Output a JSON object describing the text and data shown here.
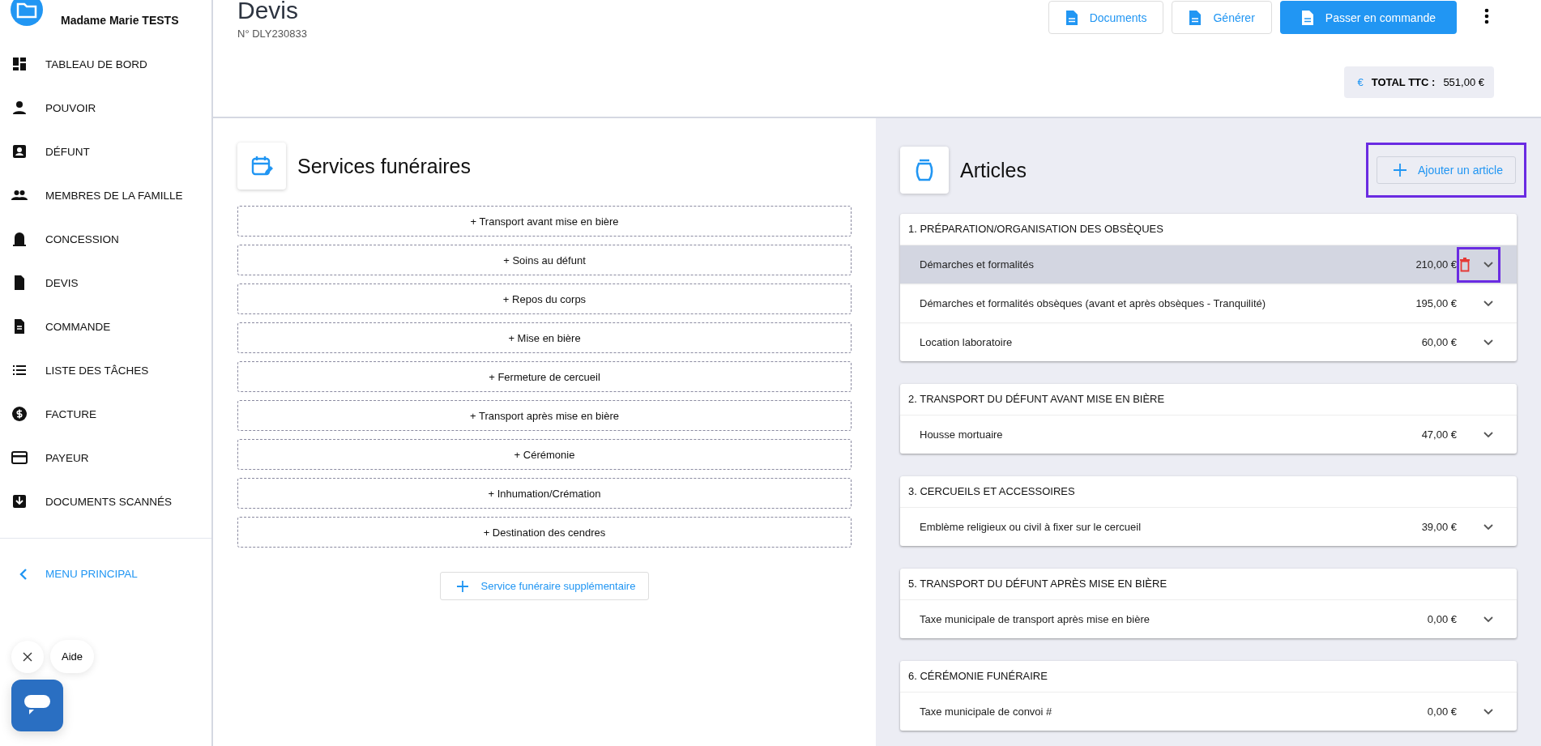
{
  "sidebar": {
    "client_name": "Madame Marie TESTS",
    "items": [
      {
        "label": "TABLEAU DE BORD"
      },
      {
        "label": "POUVOIR"
      },
      {
        "label": "DÉFUNT"
      },
      {
        "label": "MEMBRES DE LA FAMILLE"
      },
      {
        "label": "CONCESSION"
      },
      {
        "label": "DEVIS"
      },
      {
        "label": "COMMANDE"
      },
      {
        "label": "LISTE DES TÂCHES"
      },
      {
        "label": "FACTURE"
      },
      {
        "label": "PAYEUR"
      },
      {
        "label": "DOCUMENTS SCANNÉS"
      }
    ],
    "back_link": "MENU PRINCIPAL"
  },
  "help_widget": {
    "label": "Aide"
  },
  "header": {
    "title": "Devis",
    "number": "N° DLY230833",
    "buttons": [
      {
        "label": "Documents",
        "kind": "outline"
      },
      {
        "label": "Générer",
        "kind": "outline"
      },
      {
        "label": "Passer en commande",
        "kind": "primary"
      }
    ],
    "total_label": "TOTAL TTC :",
    "total_value": "551,00 €",
    "currency_symbol": "€"
  },
  "services": {
    "title": "Services funéraires",
    "items": [
      "+ Transport avant mise en bière",
      "+ Soins au défunt",
      "+ Repos du corps",
      "+ Mise en bière",
      "+ Fermeture de cercueil",
      "+ Transport après mise en bière",
      "+ Cérémonie",
      "+ Inhumation/Crémation",
      "+ Destination des cendres"
    ],
    "add_button": "Service funéraire supplémentaire"
  },
  "articles": {
    "title": "Articles",
    "add_button": {
      "label": "Ajouter un article",
      "highlighted": true
    },
    "groups": [
      {
        "title": "1. PRÉPARATION/ORGANISATION DES OBSÈQUES",
        "rows": [
          {
            "name": "Démarches et formalités",
            "price": "210,00 €",
            "selected": true,
            "highlighted": true
          },
          {
            "name": "Démarches et formalités obsèques (avant et après obsèques - Tranquilité)",
            "price": "195,00 €",
            "selected": false,
            "highlighted": false
          },
          {
            "name": "Location laboratoire",
            "price": "60,00 €",
            "selected": false,
            "highlighted": false
          }
        ]
      },
      {
        "title": "2. TRANSPORT DU DÉFUNT AVANT MISE EN BIÈRE",
        "rows": [
          {
            "name": "Housse mortuaire",
            "price": "47,00 €",
            "selected": false,
            "highlighted": false
          }
        ]
      },
      {
        "title": "3. CERCUEILS ET ACCESSOIRES",
        "rows": [
          {
            "name": "Emblème religieux ou civil à fixer sur le cercueil",
            "price": "39,00 €",
            "selected": false,
            "highlighted": false
          }
        ]
      },
      {
        "title": "5. TRANSPORT DU DÉFUNT APRÈS MISE EN BIÈRE",
        "rows": [
          {
            "name": "Taxe municipale de transport après mise en bière",
            "price": "0,00 €",
            "selected": false,
            "highlighted": false
          }
        ]
      },
      {
        "title": "6. CÉRÉMONIE FUNÉRAIRE",
        "rows": [
          {
            "name": "Taxe municipale de convoi #",
            "price": "0,00 €",
            "selected": false,
            "highlighted": false
          }
        ]
      }
    ]
  }
}
